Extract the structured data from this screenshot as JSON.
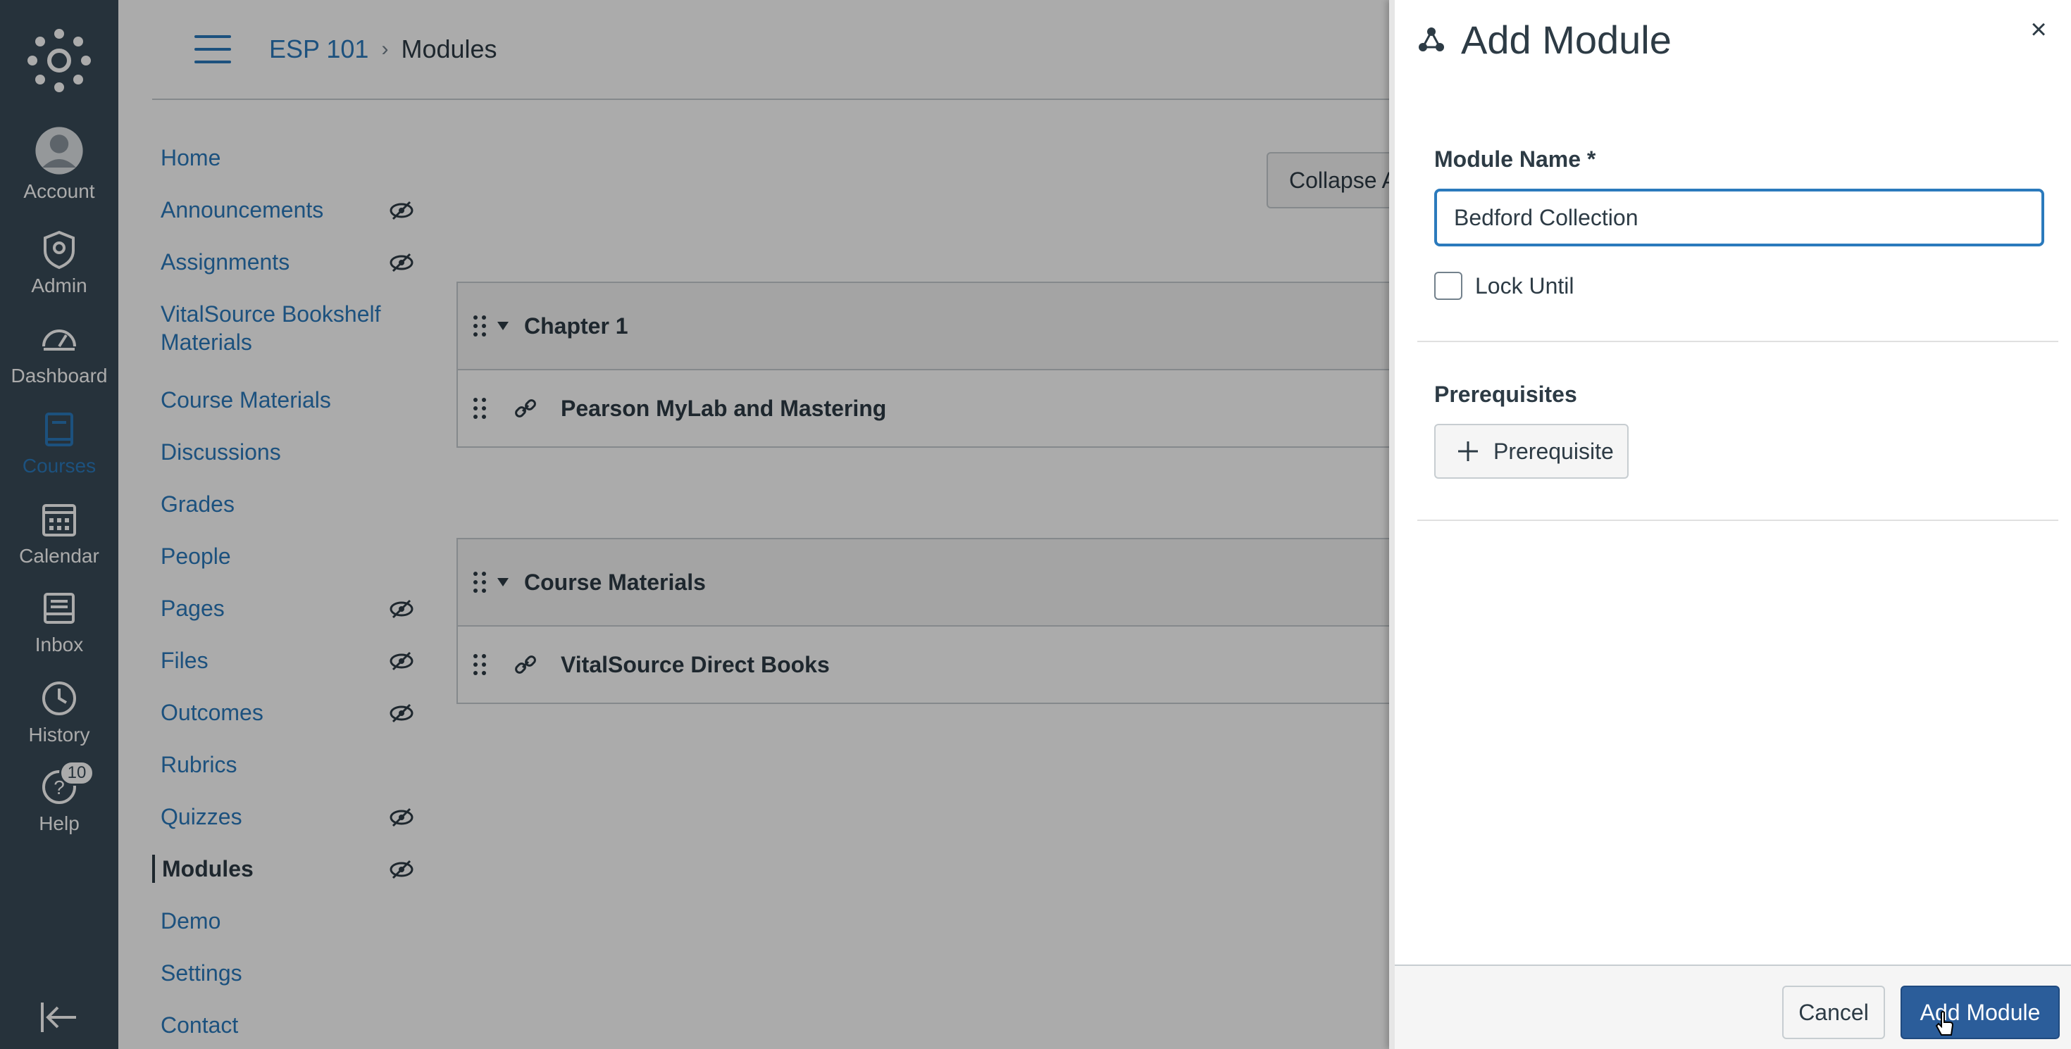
{
  "global_nav": {
    "items": [
      {
        "label": "Account",
        "icon": "account-icon"
      },
      {
        "label": "Admin",
        "icon": "admin-icon"
      },
      {
        "label": "Dashboard",
        "icon": "dashboard-icon"
      },
      {
        "label": "Courses",
        "icon": "courses-icon",
        "active": true
      },
      {
        "label": "Calendar",
        "icon": "calendar-icon"
      },
      {
        "label": "Inbox",
        "icon": "inbox-icon"
      },
      {
        "label": "History",
        "icon": "history-icon"
      },
      {
        "label": "Help",
        "icon": "help-icon",
        "badge": "10"
      }
    ]
  },
  "breadcrumb": {
    "course": "ESP 101",
    "separator": "›",
    "current": "Modules"
  },
  "course_nav": {
    "items": [
      {
        "label": "Home",
        "hidden": false
      },
      {
        "label": "Announcements",
        "hidden": true
      },
      {
        "label": "Assignments",
        "hidden": true
      },
      {
        "label": "VitalSource Bookshelf",
        "label2": "Materials",
        "hidden": false
      },
      {
        "label": "Course Materials",
        "hidden": false
      },
      {
        "label": "Discussions",
        "hidden": false
      },
      {
        "label": "Grades",
        "hidden": false
      },
      {
        "label": "People",
        "hidden": false
      },
      {
        "label": "Pages",
        "hidden": true
      },
      {
        "label": "Files",
        "hidden": true
      },
      {
        "label": "Outcomes",
        "hidden": true
      },
      {
        "label": "Rubrics",
        "hidden": false
      },
      {
        "label": "Quizzes",
        "hidden": true
      },
      {
        "label": "Modules",
        "hidden": true,
        "active": true
      },
      {
        "label": "Demo",
        "hidden": false
      },
      {
        "label": "Settings",
        "hidden": false
      },
      {
        "label": "Contact",
        "hidden": false
      }
    ]
  },
  "toolbar": {
    "collapse_all": "Collapse Al"
  },
  "modules": [
    {
      "title": "Chapter 1",
      "items": [
        {
          "title": "Pearson MyLab and Mastering"
        }
      ]
    },
    {
      "title": "Course Materials",
      "items": [
        {
          "title": "VitalSource Direct Books"
        }
      ]
    }
  ],
  "tray": {
    "title": "Add Module",
    "close": "×",
    "module_name_label": "Module Name *",
    "module_name_value": "Bedford Collection",
    "lock_until_label": "Lock Until",
    "prerequisites_label": "Prerequisites",
    "prerequisite_button": "Prerequisite",
    "cancel": "Cancel",
    "add_module": "Add Module"
  },
  "colors": {
    "nav_bg": "#394b58",
    "link": "#2b7abc",
    "primary_button": "#2b5d9a"
  }
}
